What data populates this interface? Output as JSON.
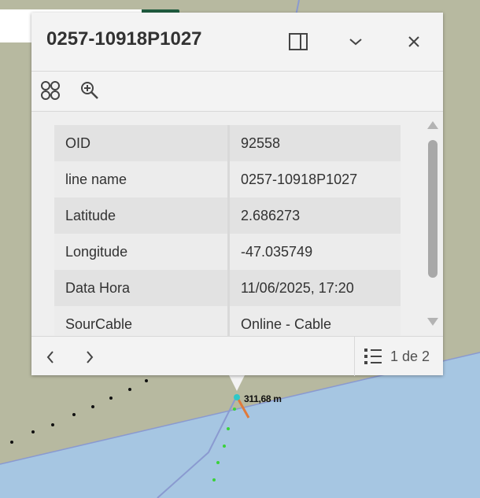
{
  "colors": {
    "land": "#b7b9a0",
    "water": "#a6c6e2",
    "accent": "#1f5c3f",
    "segment": "#e07a3a",
    "point": "#2ec8c8"
  },
  "map": {
    "scale_label": "311,68 m"
  },
  "popup": {
    "title": "0257-10918P1027",
    "header_icons": [
      "dock-icon",
      "collapse-chevron-icon",
      "close-icon"
    ],
    "toolbar_icons": [
      "select-features-icon",
      "zoom-to-icon"
    ],
    "fields": [
      {
        "label": "OID",
        "value": "92558"
      },
      {
        "label": "line name",
        "value": "0257-10918P1027"
      },
      {
        "label": "Latitude",
        "value": "2.686273"
      },
      {
        "label": "Longitude",
        "value": "-47.035749"
      },
      {
        "label": "Data Hora",
        "value": "11/06/2025, 17:20"
      },
      {
        "label": "SourCable",
        "value": "Online - Cable"
      }
    ],
    "footer": {
      "page_indicator": "1 de 2"
    }
  }
}
